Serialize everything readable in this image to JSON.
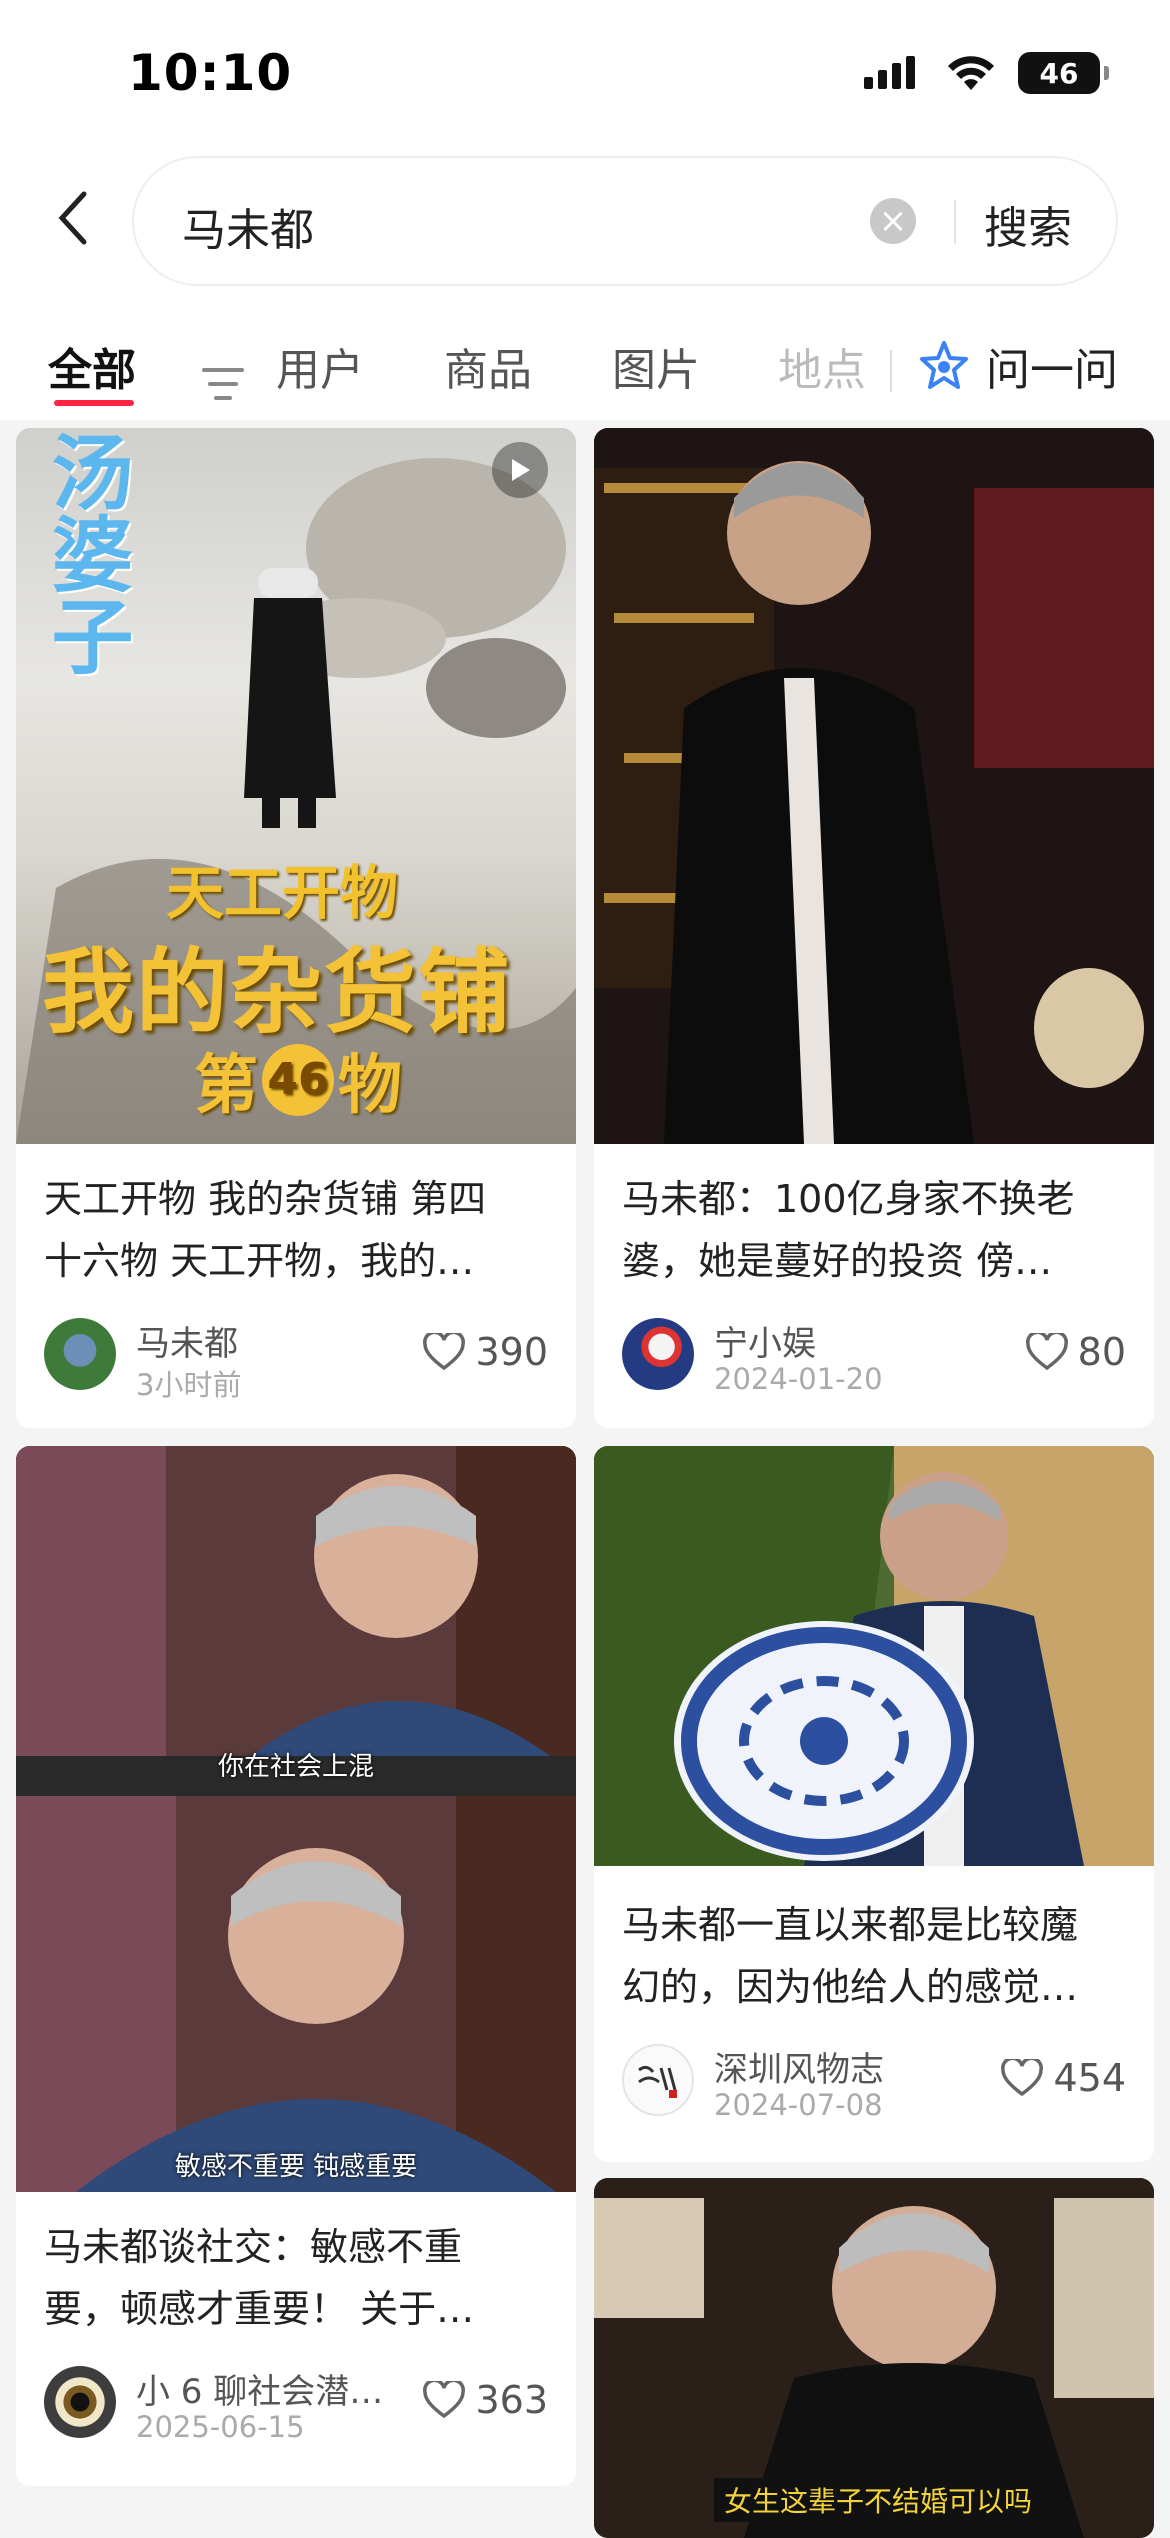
{
  "status": {
    "time": "10:10",
    "battery": "46"
  },
  "search": {
    "query": "马未都",
    "button": "搜索"
  },
  "tabs": [
    {
      "label": "全部"
    },
    {
      "label": "用户"
    },
    {
      "label": "商品"
    },
    {
      "label": "图片"
    },
    {
      "label": "地点"
    }
  ],
  "ask": {
    "label": "问一问"
  },
  "cards": [
    {
      "title_line1": "天工开物 我的杂货铺 第四",
      "title_line2": "十六物 天工开物，我的…",
      "author": "马未都",
      "date": "3小时前",
      "likes": "390",
      "overlay_top": "汤婆子",
      "overlay_mid": "天工开物",
      "overlay_big": "我的杂货铺",
      "overlay_num_pre": "第",
      "overlay_num": "46",
      "overlay_num_post": "物"
    },
    {
      "title_line1": "马未都：100亿身家不换老",
      "title_line2": "婆，她是蔓好的投资 傍…",
      "author": "宁小娱",
      "date": "2024-01-20",
      "likes": "80"
    },
    {
      "title_line1": "马未都谈社交：敏感不重",
      "title_line2": "要，顿感才重要！ 关于…",
      "author": "小 6 聊社会潜…",
      "date": "2025-06-15",
      "likes": "363",
      "caption1": "你在社会上混",
      "caption2": "敏感不重要 钝感重要"
    },
    {
      "title_line1": "马未都一直以来都是比较魔",
      "title_line2": "幻的，因为他给人的感觉…",
      "author": "深圳风物志",
      "date": "2024-07-08",
      "likes": "454"
    },
    {
      "caption": "女生这辈子不结婚可以吗"
    }
  ],
  "colors": {
    "accent": "#ff2442",
    "ask_icon": "#3b82f6"
  }
}
